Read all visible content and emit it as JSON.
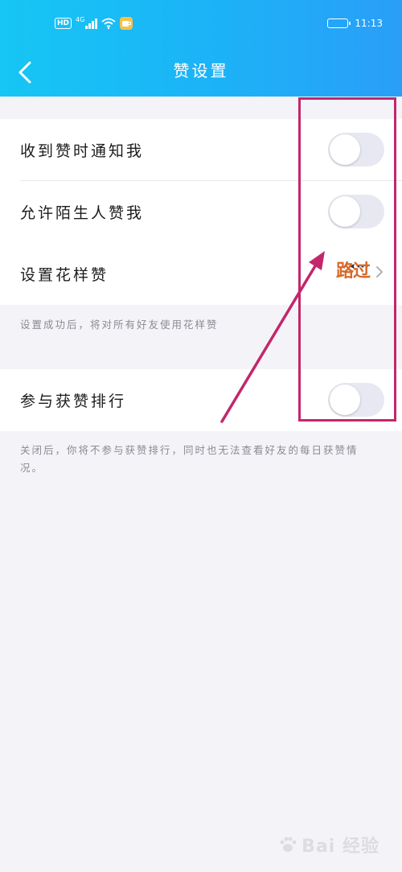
{
  "status_bar": {
    "hd": "HD",
    "network": "4G",
    "time": "11:13"
  },
  "nav": {
    "title": "赞设置"
  },
  "settings": {
    "notify_label": "收到赞时通知我",
    "stranger_label": "允许陌生人赞我",
    "style_label": "设置花样赞",
    "style_value": "路过",
    "style_note": "设置成功后，将对所有好友使用花样赞",
    "ranking_label": "参与获赞排行",
    "ranking_note": "关闭后，你将不参与获赞排行，同时也无法查看好友的每日获赞情况。"
  },
  "toggles": {
    "notify": false,
    "stranger": false,
    "ranking": false
  },
  "watermark": {
    "text": "Bai 经验"
  },
  "colors": {
    "header_start": "#16c6f4",
    "header_end": "#2a9ef8",
    "annotation": "#c2276b",
    "toggle_off": "#e7e8f1",
    "style_badge": "#d8692a"
  },
  "icons": {
    "back": "chevron-left-icon",
    "chevron": "chevron-right-icon",
    "wifi": "wifi-icon",
    "signal": "signal-icon",
    "battery": "battery-icon"
  }
}
